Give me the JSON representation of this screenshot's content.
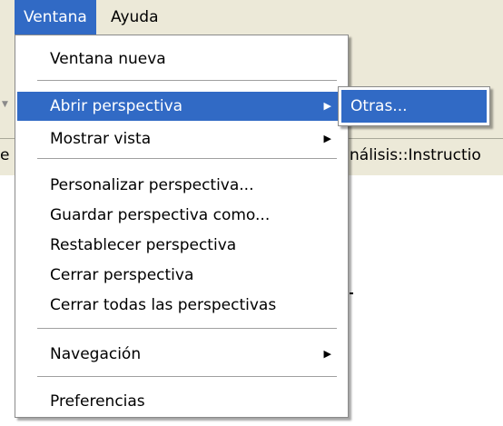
{
  "menubar": {
    "items": [
      {
        "label": "Ventana"
      },
      {
        "label": "Ayuda"
      }
    ]
  },
  "background": {
    "left_fragment": "e",
    "right_fragment": "nálisis::Instructio"
  },
  "menu": {
    "items": [
      {
        "label": "Ventana nueva"
      },
      {
        "label": "Abrir perspectiva"
      },
      {
        "label": "Mostrar vista"
      },
      {
        "label": "Personalizar perspectiva..."
      },
      {
        "label": "Guardar perspectiva como..."
      },
      {
        "label": "Restablecer perspectiva"
      },
      {
        "label": "Cerrar perspectiva"
      },
      {
        "label": "Cerrar todas las perspectivas"
      },
      {
        "label": "Navegación"
      },
      {
        "label": "Preferencias"
      }
    ]
  },
  "submenu": {
    "items": [
      {
        "label": "Otras..."
      }
    ]
  },
  "icons": {
    "submenu_arrow": "triangle-right"
  },
  "colors": {
    "highlight": "#316ac5",
    "menubar_bg": "#ece9d8"
  }
}
